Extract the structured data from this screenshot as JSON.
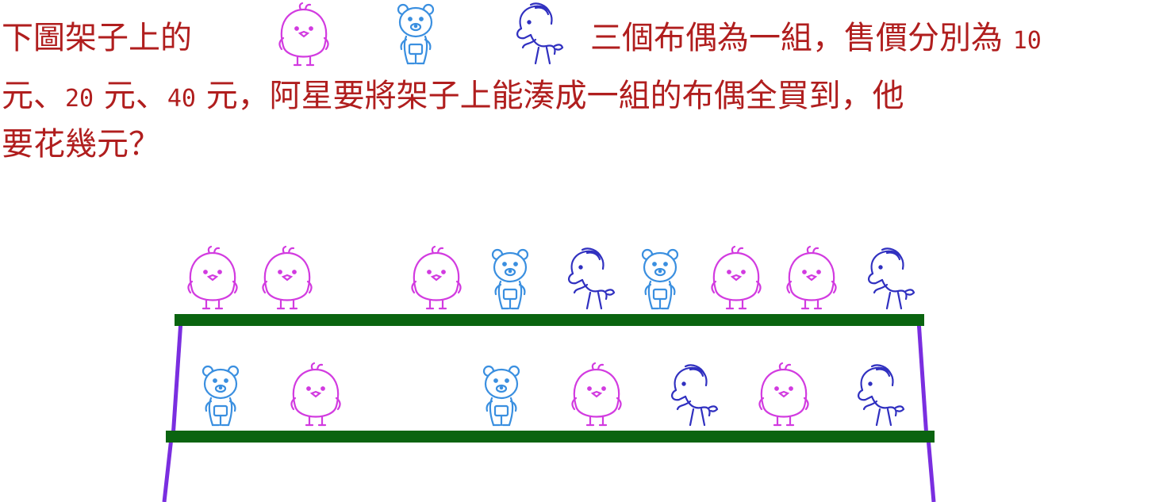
{
  "question": {
    "line1_start": "下圖架子上的",
    "line1_mid": "三個布偶為一組，售價分別為",
    "price1": "10",
    "unit1": "元、",
    "price2": "20",
    "unit2": "元、",
    "price3": "40",
    "line2_rest": "元，阿星要將架子上能湊成一組的布偶全買到，他",
    "line3": "要花幾元？"
  },
  "colors": {
    "text": "#b01e1e",
    "chick": "#d23be0",
    "bear": "#3a8fe0",
    "horse": "#3030c0",
    "shelf_board": "#0a6410",
    "shelf_leg": "#7a2ee0"
  },
  "toys": {
    "legend": [
      "chick",
      "bear",
      "horse"
    ],
    "top_shelf": [
      "chick",
      "chick",
      "chick",
      "bear",
      "horse",
      "bear",
      "chick",
      "chick",
      "horse"
    ],
    "bottom_shelf": [
      "bear",
      "chick",
      "bear",
      "chick",
      "horse",
      "chick",
      "horse"
    ]
  }
}
